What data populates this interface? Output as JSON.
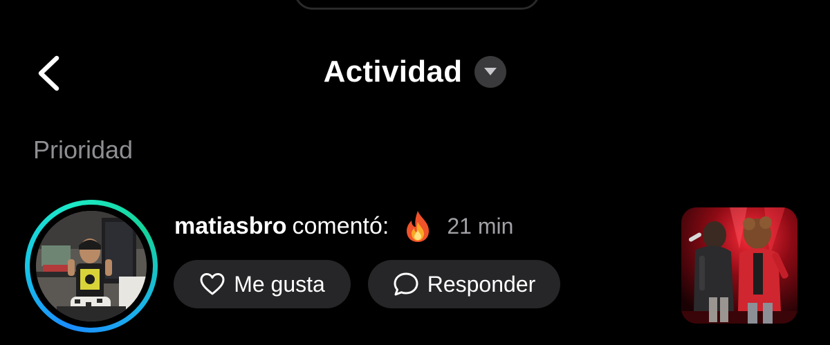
{
  "header": {
    "title": "Actividad",
    "back_icon": "chevron-left-icon",
    "dropdown_icon": "caret-down-icon"
  },
  "section": {
    "label": "Prioridad"
  },
  "notification": {
    "username": "matiasbro",
    "action": "comentó:",
    "comment_emoji": "🔥",
    "time": "21 min",
    "like_label": "Me gusta",
    "reply_label": "Responder",
    "like_icon": "heart-outline-icon",
    "reply_icon": "speech-bubble-icon",
    "story_ring_colors": [
      "#1b8cff",
      "#1de9c6"
    ]
  },
  "colors": {
    "background": "#000000",
    "pill": "#262628",
    "muted_text": "#8e8e93"
  }
}
